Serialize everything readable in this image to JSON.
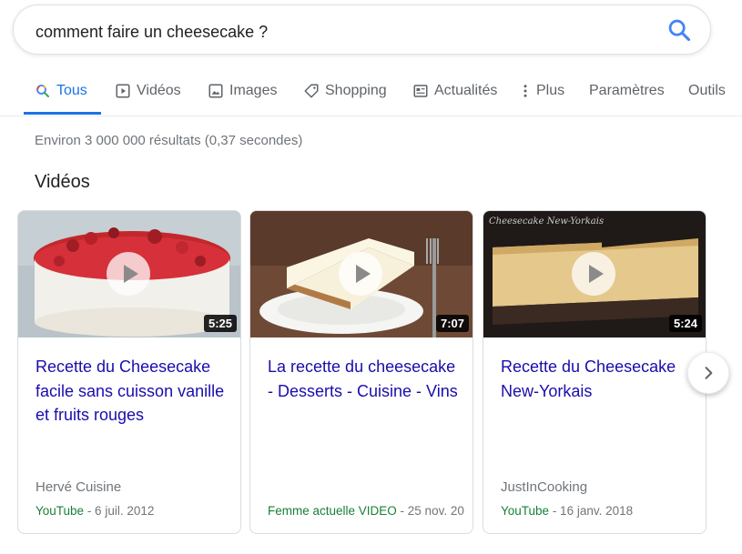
{
  "search": {
    "query": "comment faire un cheesecake ?",
    "icon": "search-icon"
  },
  "tabs": [
    {
      "label": "Tous",
      "icon": "search-icon",
      "active": true
    },
    {
      "label": "Vidéos",
      "icon": "video-icon"
    },
    {
      "label": "Images",
      "icon": "image-icon"
    },
    {
      "label": "Shopping",
      "icon": "tag-icon"
    },
    {
      "label": "Actualités",
      "icon": "news-icon"
    },
    {
      "label": "Plus",
      "icon": "more-vert-icon"
    },
    {
      "label": "Paramètres"
    },
    {
      "label": "Outils"
    }
  ],
  "results_stats": "Environ 3 000 000 résultats (0,37 secondes)",
  "videos_section": {
    "title": "Vidéos",
    "cards": [
      {
        "title": "Recette du Cheesecake facile sans cuisson vanille et fruits rouges",
        "duration": "5:25",
        "channel": "Hervé Cuisine",
        "source": "YouTube",
        "date": " - 6 juil. 2012"
      },
      {
        "title": "La recette du cheesecake - Desserts - Cuisine - Vins",
        "duration": "7:07",
        "channel": "",
        "source": "Femme actuelle VIDEO",
        "date": " - 25 nov. 20"
      },
      {
        "title": "Recette du Cheesecake New-Yorkais",
        "duration": "5:24",
        "channel": "JustInCooking",
        "source": "YouTube",
        "date": " - 16 janv. 2018",
        "thumb_caption": "Cheesecake New-Yorkais"
      }
    ],
    "next_icon": "chevron-right-icon"
  },
  "colors": {
    "link": "#1a0dab",
    "accent": "#1a73e8",
    "source_green": "#188038",
    "muted": "#70757a"
  }
}
